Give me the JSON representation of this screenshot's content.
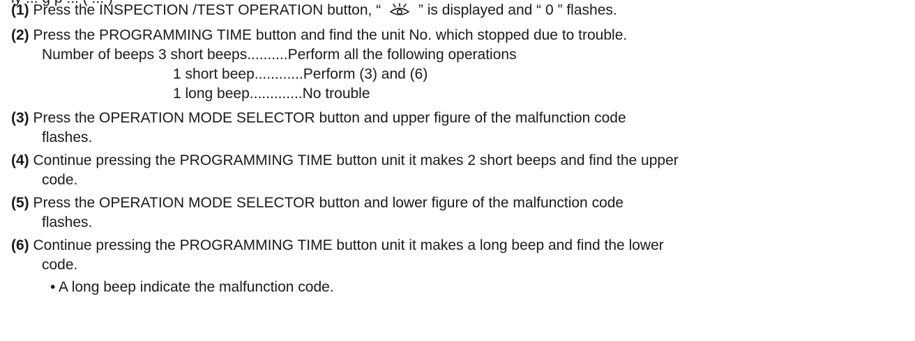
{
  "header_cutoff": "ly ... g p ... ( ... )",
  "steps": [
    {
      "num": "(1)",
      "text_a": "Press the INSPECTION /TEST OPERATION button, “",
      "text_b": "” is displayed and “ 0 ” flashes."
    },
    {
      "num": "(2)",
      "lines": [
        "Press the PROGRAMMING TIME button and find the unit No. which stopped due to trouble."
      ]
    },
    {
      "num": "(3)",
      "lines": [
        "Press the OPERATION MODE SELECTOR button and upper figure of the malfunction code",
        "flashes."
      ]
    },
    {
      "num": "(4)",
      "lines": [
        "Continue pressing the PROGRAMMING TIME button unit it makes 2 short beeps and find the upper",
        "code."
      ]
    },
    {
      "num": "(5)",
      "lines": [
        "Press the OPERATION MODE SELECTOR button and lower figure of the malfunction code",
        "flashes."
      ]
    },
    {
      "num": "(6)",
      "lines": [
        "Continue pressing the PROGRAMMING TIME button unit it makes a long beep and find the lower",
        "code."
      ]
    }
  ],
  "beeps": {
    "label": "Number of beeps",
    "rows": [
      {
        "beep": "3 short beeps",
        "dots": "..........",
        "action": "Perform all the following operations"
      },
      {
        "beep": "1 short beep",
        "dots": "............",
        "action": "Perform (3) and (6)"
      },
      {
        "beep": "1 long beep",
        "dots": ".............",
        "action": "No trouble"
      }
    ]
  },
  "note": "• A long beep indicate the malfunction code."
}
